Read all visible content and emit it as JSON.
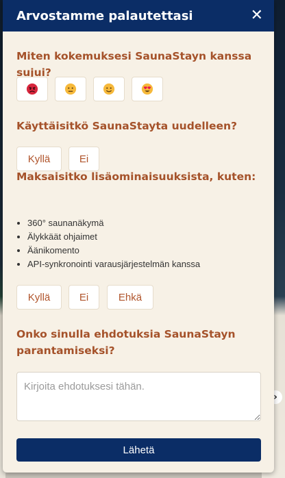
{
  "modal": {
    "title": "Arvostamme palautettasi",
    "close_icon": "close-icon"
  },
  "q1": {
    "question": "Miten kokemuksesi SaunaStayn kanssa sujui?",
    "emojis": [
      "angry-face-icon",
      "neutral-face-icon",
      "smiling-face-icon",
      "heart-eyes-face-icon"
    ]
  },
  "q2": {
    "question": "Käyttäisitkö SaunaStayta uudelleen?",
    "yes": "Kyllä",
    "no": "Ei"
  },
  "q3": {
    "question": "Maksaisitko lisäominaisuuksista, kuten:",
    "features": [
      "360° saunanäkymä",
      "Älykkäät ohjaimet",
      "Äänikomento",
      "API-synkronointi varausjärjestelmän kanssa"
    ],
    "yes": "Kyllä",
    "no": "Ei",
    "maybe": "Ehkä"
  },
  "q4": {
    "question": "Onko sinulla ehdotuksia SaunaStayn parantamiseksi?",
    "placeholder": "Kirjoita ehdotuksesi tähän.",
    "value": ""
  },
  "submit_label": "Lähetä",
  "colors": {
    "header": "#0b2d66",
    "question": "#a5522a",
    "background": "#f7f1e6"
  }
}
